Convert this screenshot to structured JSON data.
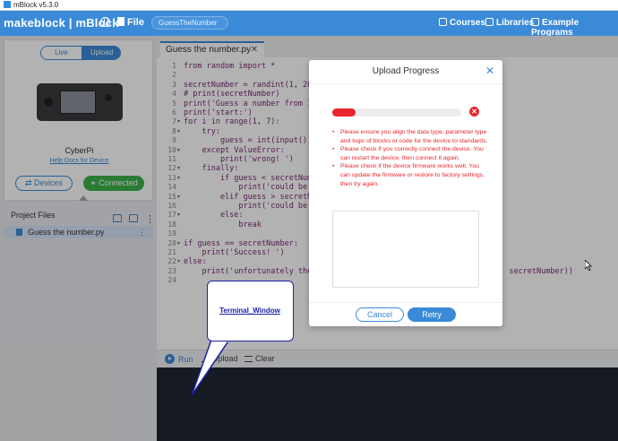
{
  "window": {
    "title": "mBlock v5.3.0"
  },
  "nav": {
    "brand": "makeblock | mBlock",
    "file_label": "File",
    "project_name": "GuessTheNumber",
    "courses": "Courses",
    "libraries": "Libraries",
    "example_programs": "Example Programs"
  },
  "device": {
    "mode_live": "Live",
    "mode_upload": "Upload",
    "name": "CyberPi",
    "help_link": "Help Docs for Device",
    "devices_button": "Devices",
    "connected_button": "Connected"
  },
  "project_files": {
    "header": "Project Files",
    "items": [
      {
        "name": "Guess the number.py"
      }
    ]
  },
  "editor": {
    "tab_label": "Guess the number.py",
    "lines": [
      {
        "num": "1",
        "fold": "",
        "text": "from random import *"
      },
      {
        "num": "2",
        "fold": "",
        "text": ""
      },
      {
        "num": "3",
        "fold": "",
        "text": "secretNumber = randint(1, 20)"
      },
      {
        "num": "4",
        "fold": "",
        "text": "# print(secretNumber)"
      },
      {
        "num": "5",
        "fold": "",
        "text": "print('Guess a number from 1 "
      },
      {
        "num": "6",
        "fold": "",
        "text": "print('start:')"
      },
      {
        "num": "7",
        "fold": "▾",
        "text": "for i in range(1, 7):"
      },
      {
        "num": "8",
        "fold": "▾",
        "text": "    try:"
      },
      {
        "num": "9",
        "fold": "",
        "text": "        guess = int(input())"
      },
      {
        "num": "10",
        "fold": "▾",
        "text": "    except ValueError:"
      },
      {
        "num": "11",
        "fold": "",
        "text": "        print('wrong! ')"
      },
      {
        "num": "12",
        "fold": "▾",
        "text": "    finally:"
      },
      {
        "num": "13",
        "fold": "▾",
        "text": "        if guess < secretNumbe"
      },
      {
        "num": "14",
        "fold": "",
        "text": "            print('could be hi"
      },
      {
        "num": "15",
        "fold": "▾",
        "text": "        elif guess > secretNum"
      },
      {
        "num": "16",
        "fold": "",
        "text": "            print('could be sm"
      },
      {
        "num": "17",
        "fold": "▾",
        "text": "        else:"
      },
      {
        "num": "18",
        "fold": "",
        "text": "            break"
      },
      {
        "num": "19",
        "fold": "",
        "text": ""
      },
      {
        "num": "20",
        "fold": "▾",
        "text": "if guess == secretNumber:"
      },
      {
        "num": "21",
        "fold": "",
        "text": "    print('Success! ')"
      },
      {
        "num": "22",
        "fold": "▾",
        "text": "else:"
      },
      {
        "num": "23",
        "fold": "",
        "text": "    print('unfortunately the c                                         secretNumber))"
      },
      {
        "num": "24",
        "fold": "",
        "text": ""
      }
    ]
  },
  "toolbar": {
    "run": "Run",
    "upload": "Upload",
    "clear": "Clear"
  },
  "modal": {
    "title": "Upload Progress",
    "progress_fraction": 0.18,
    "messages": [
      "Please ensure you align the data type, parameter type and logic of blocks or code for the device to standards.",
      "Please check if you correctly connect the device. You can restart the device, then connect it again.",
      "Please check if the device firmware works well. You can update the firmware or restore to factory settings, then try again."
    ],
    "cancel": "Cancel",
    "retry": "Retry"
  },
  "annotation": {
    "text": "Terminal_Window"
  },
  "colors": {
    "accent": "#3b8ad8",
    "error": "#e8262e",
    "success": "#3db14a",
    "terminal": "#1f2633",
    "annotation": "#1c22a6"
  }
}
